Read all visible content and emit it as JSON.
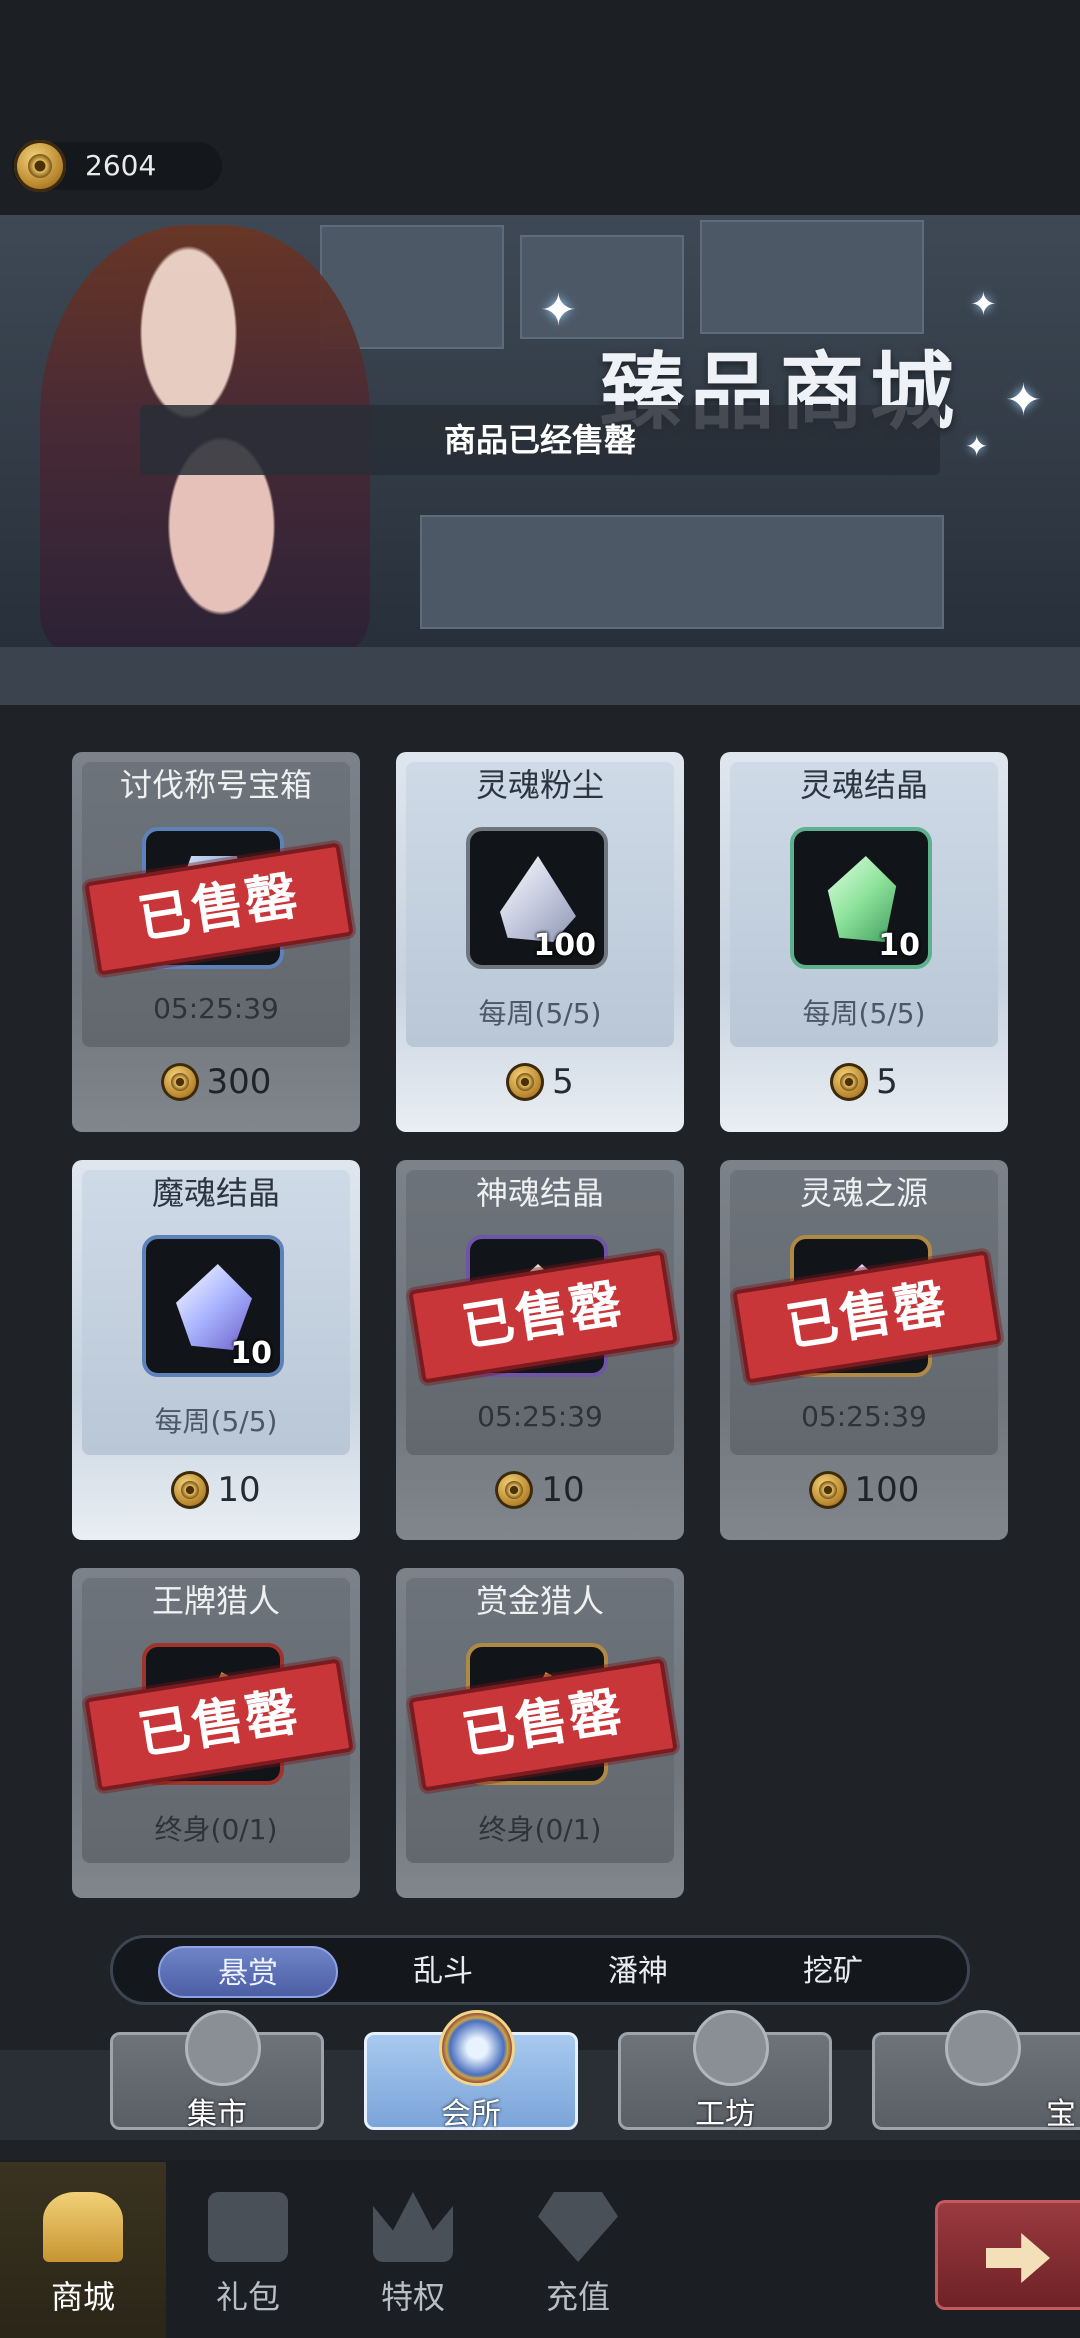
{
  "currency": {
    "amount": "2604"
  },
  "banner": {
    "title": "臻品商城",
    "notice": "商品已经售罄"
  },
  "stamp_text": "已售罄",
  "items": [
    {
      "name": "讨伐称号宝箱",
      "sub": "05:25:39",
      "price": "300",
      "qty": "",
      "state": "soldout",
      "gem": "chestgem",
      "frame": "blue"
    },
    {
      "name": "灵魂粉尘",
      "sub": "每周(5/5)",
      "price": "5",
      "qty": "100",
      "state": "active",
      "gem": "white",
      "frame": ""
    },
    {
      "name": "灵魂结晶",
      "sub": "每周(5/5)",
      "price": "5",
      "qty": "10",
      "state": "active",
      "gem": "green",
      "frame": "green"
    },
    {
      "name": "魔魂结晶",
      "sub": "每周(5/5)",
      "price": "10",
      "qty": "10",
      "state": "active",
      "gem": "bluepurple",
      "frame": "blue"
    },
    {
      "name": "神魂结晶",
      "sub": "05:25:39",
      "price": "10",
      "qty": "",
      "state": "soldout",
      "gem": "pale",
      "frame": "purple"
    },
    {
      "name": "灵魂之源",
      "sub": "05:25:39",
      "price": "100",
      "qty": "",
      "state": "soldout",
      "gem": "pink",
      "frame": "gold"
    },
    {
      "name": "王牌猎人",
      "sub": "终身(0/1)",
      "price": "",
      "qty": "",
      "state": "soldout",
      "gem": "orange",
      "frame": "red"
    },
    {
      "name": "赏金猎人",
      "sub": "终身(0/1)",
      "price": "",
      "qty": "",
      "state": "soldout",
      "gem": "orange",
      "frame": "gold"
    }
  ],
  "tabs": [
    "悬赏",
    "乱斗",
    "潘神",
    "挖矿"
  ],
  "categories": [
    "集市",
    "会所",
    "工坊",
    "宝"
  ],
  "nav": [
    "商城",
    "礼包",
    "特权",
    "充值"
  ]
}
